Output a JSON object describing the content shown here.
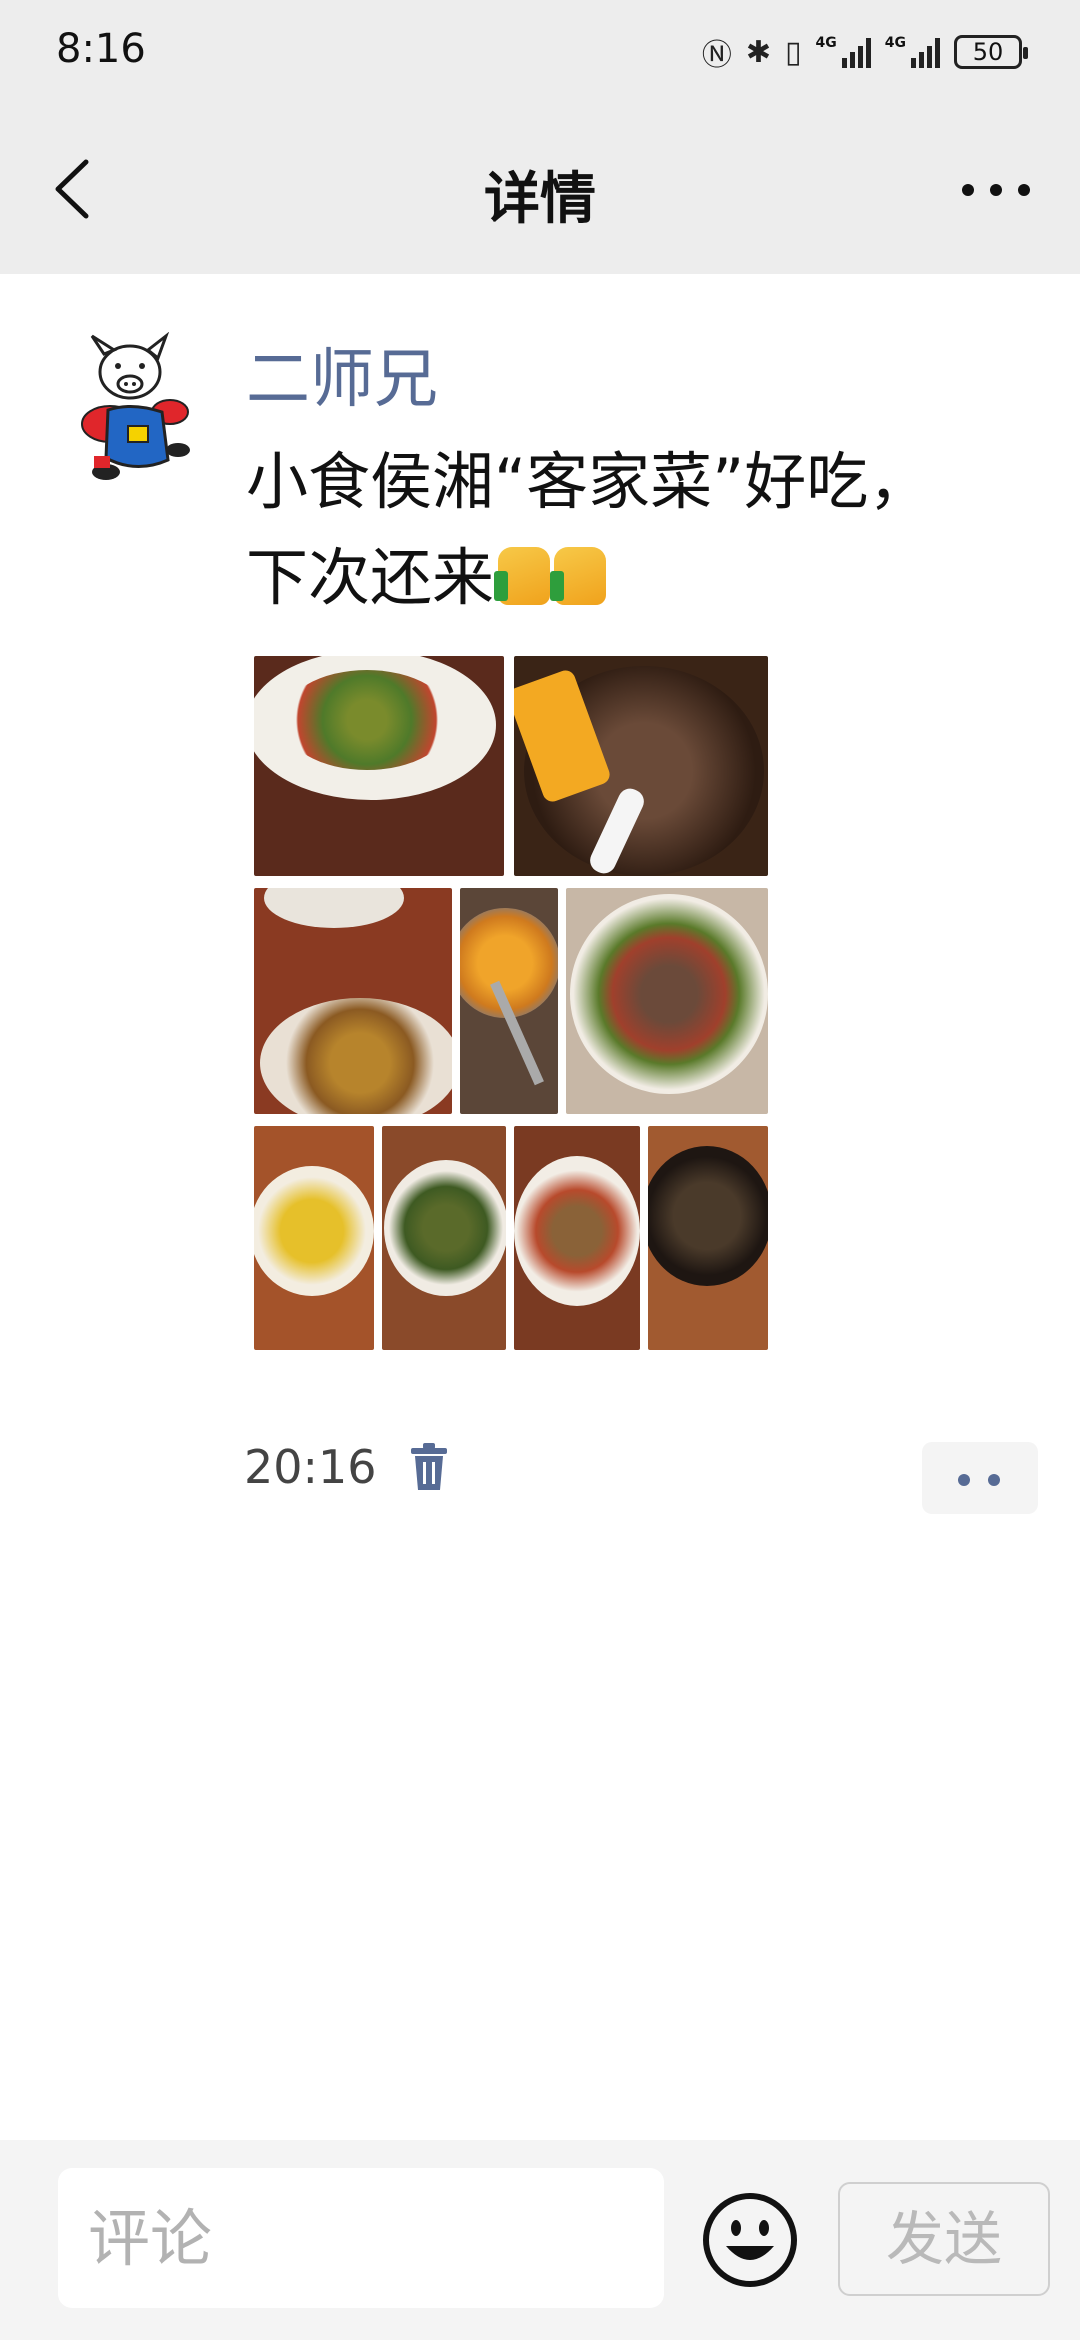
{
  "status_bar": {
    "time": "8:16",
    "network_1": "4G",
    "network_2": "4G",
    "battery": "50"
  },
  "nav": {
    "title": "详情",
    "back_icon": "chevron-left-icon",
    "more_icon": "more-horizontal-icon"
  },
  "post": {
    "author": "二师兄",
    "author_color": "#576b95",
    "text": "小食侯湘“客家菜”好吃，下次还来",
    "emojis": [
      "thumbs-up-emoji",
      "thumbs-up-emoji"
    ],
    "photo_count": 9,
    "time": "20:16",
    "delete_icon": "trash-icon",
    "action_icon": "two-dots-icon"
  },
  "composer": {
    "placeholder": "评论",
    "emoji_icon": "smiley-face-icon",
    "send_label": "发送"
  }
}
